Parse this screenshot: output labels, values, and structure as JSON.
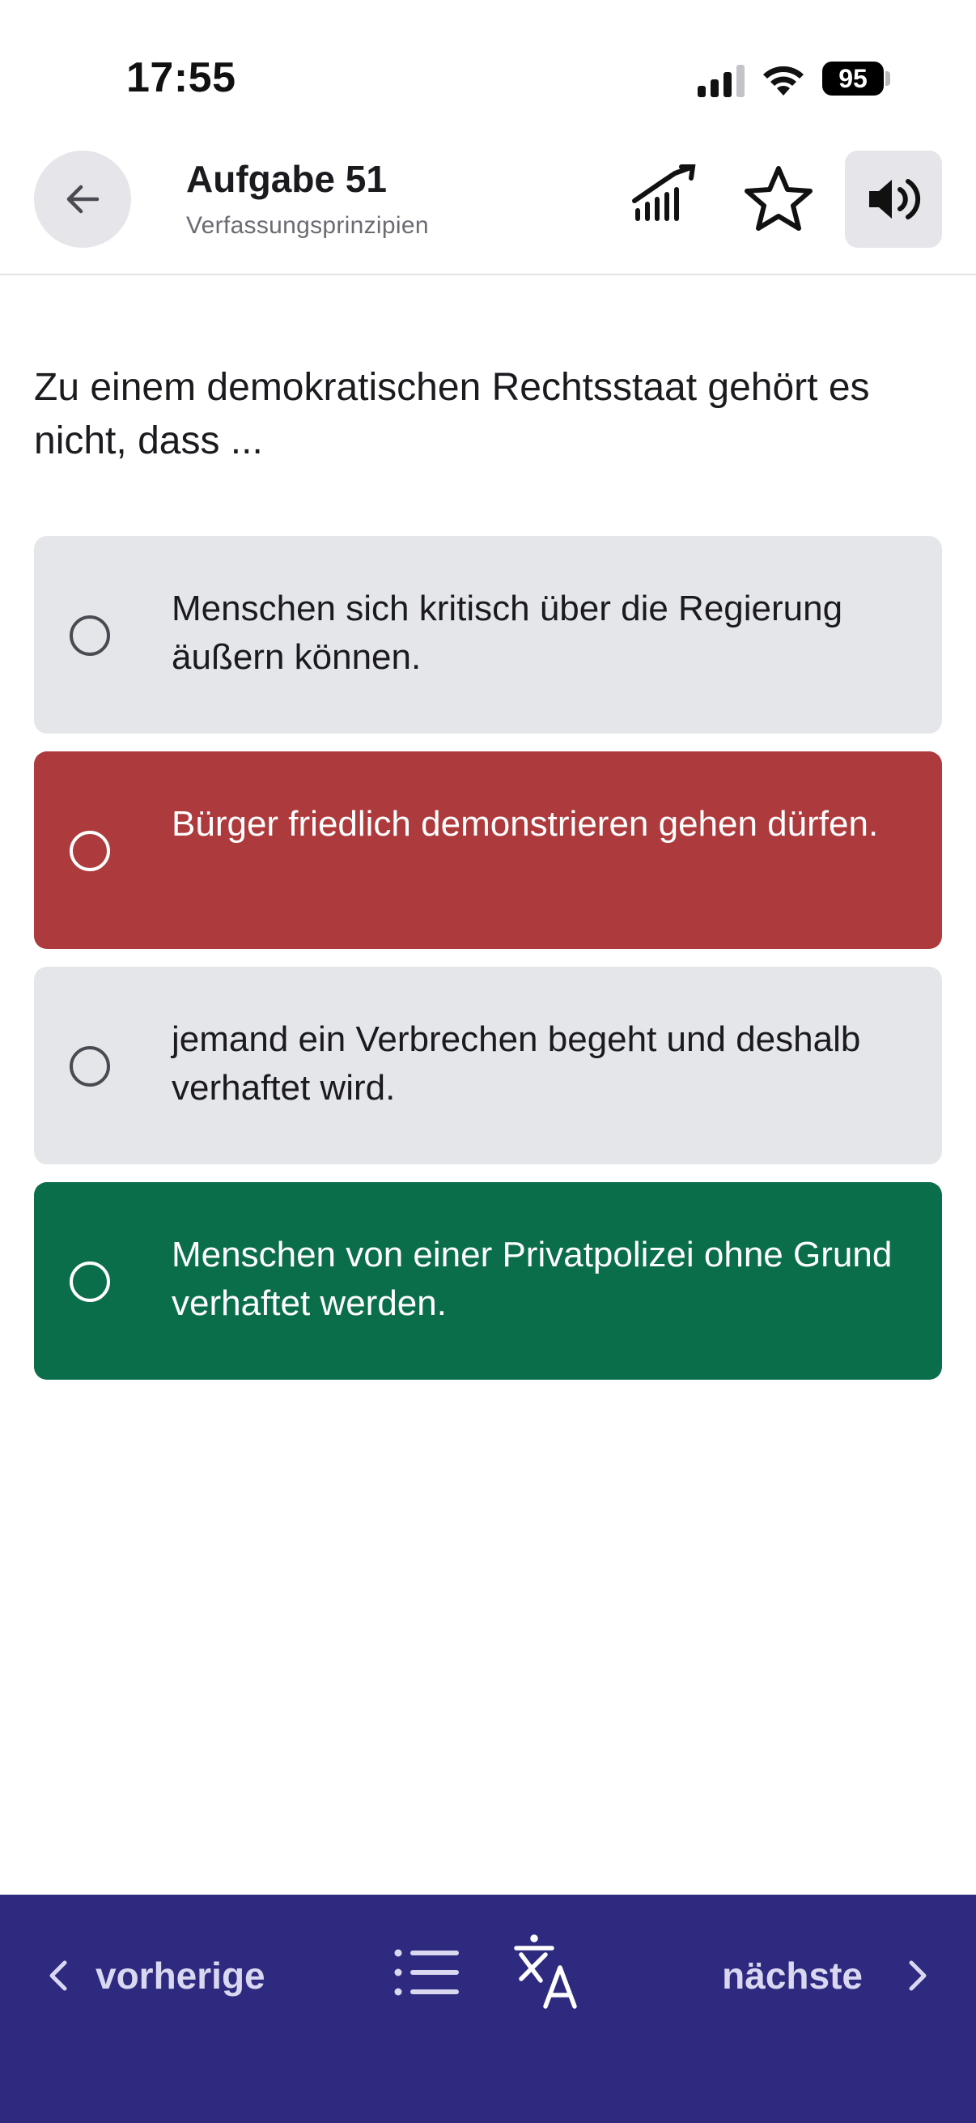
{
  "status_bar": {
    "time": "17:55",
    "battery": "95"
  },
  "header": {
    "title": "Aufgabe 51",
    "subtitle": "Verfassungsprinzipien",
    "icons": [
      "back-arrow-icon",
      "stats-icon",
      "star-icon",
      "speaker-icon"
    ]
  },
  "question": {
    "text": "Zu einem demokratischen Rechtsstaat gehört es nicht, dass ..."
  },
  "answers": [
    {
      "label": "Menschen sich kritisch über die Regierung äußern können.",
      "state": "neutral"
    },
    {
      "label": "Bürger friedlich demonstrieren gehen dürfen.",
      "state": "wrong"
    },
    {
      "label": "jemand ein Verbrechen begeht und deshalb verhaftet wird.",
      "state": "neutral"
    },
    {
      "label": "Menschen von einer Privatpolizei ohne Grund verhaftet werden.",
      "state": "correct"
    }
  ],
  "colors": {
    "wrong": "#ad3a3c",
    "correct": "#0b6e4b",
    "neutral": "#e5e6ea",
    "nav_bar": "#2e2a7f"
  },
  "bottom_nav": {
    "prev_label": "vorherige",
    "next_label": "nächste",
    "icons": [
      "chevron-left-icon",
      "list-icon",
      "translate-icon",
      "chevron-right-icon"
    ]
  }
}
